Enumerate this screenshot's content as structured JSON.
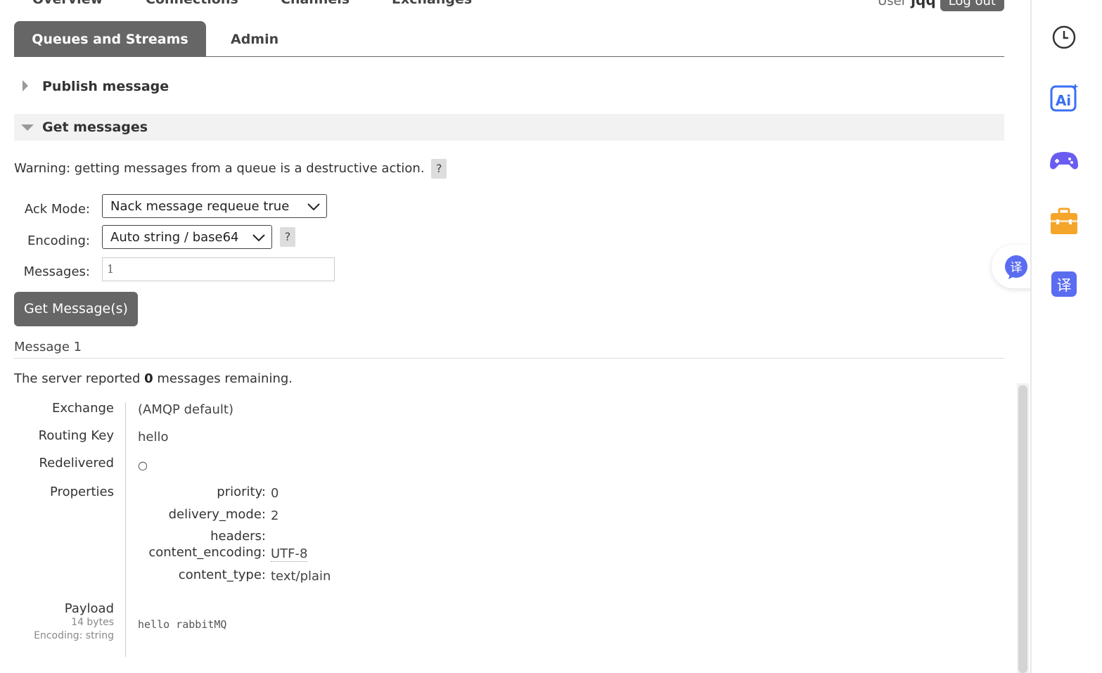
{
  "nav": {
    "tabs": [
      "Overview",
      "Connections",
      "Channels",
      "Exchanges"
    ],
    "active_tab": "Queues and Streams",
    "admin_tab": "Admin",
    "user_label": "User",
    "user_name": "jqq",
    "logout": "Log out"
  },
  "sections": {
    "publish": "Publish message",
    "get": "Get messages"
  },
  "get_messages": {
    "warning": "Warning: getting messages from a queue is a destructive action.",
    "help": "?",
    "ack_mode_label": "Ack Mode:",
    "ack_mode_value": "Nack message requeue true",
    "encoding_label": "Encoding:",
    "encoding_value": "Auto string / base64",
    "messages_label": "Messages:",
    "messages_value": "1",
    "button": "Get Message(s)"
  },
  "result": {
    "title": "Message 1",
    "server_prefix": "The server reported",
    "remaining": "0",
    "server_suffix": "messages remaining.",
    "exchange_label": "Exchange",
    "exchange_value": "(AMQP default)",
    "routing_label": "Routing Key",
    "routing_value": "hello",
    "redelivered_label": "Redelivered",
    "redelivered_value": "○",
    "properties_label": "Properties",
    "properties": [
      {
        "key": "priority:",
        "value": "0"
      },
      {
        "key": "delivery_mode:",
        "value": "2"
      },
      {
        "key": "headers:",
        "value": ""
      },
      {
        "key": "content_encoding:",
        "value": "UTF-8"
      },
      {
        "key": "content_type:",
        "value": "text/plain"
      }
    ],
    "payload_label": "Payload",
    "payload_bytes": "14 bytes",
    "payload_encoding": "Encoding: string",
    "payload_value": "hello rabbitMQ"
  },
  "sidebar": {
    "icons": [
      "clock-icon",
      "ai-icon",
      "gamepad-icon",
      "toolbox-icon",
      "translate-icon"
    ],
    "translate_glyph": "译",
    "ai_text": "Ai"
  },
  "colors": {
    "tab_bg": "#666666",
    "section_bg": "#f2f2f2",
    "accent_blue": "#3b6ff5",
    "accent_purple": "#6a5cf0",
    "accent_orange": "#f4a52a"
  }
}
